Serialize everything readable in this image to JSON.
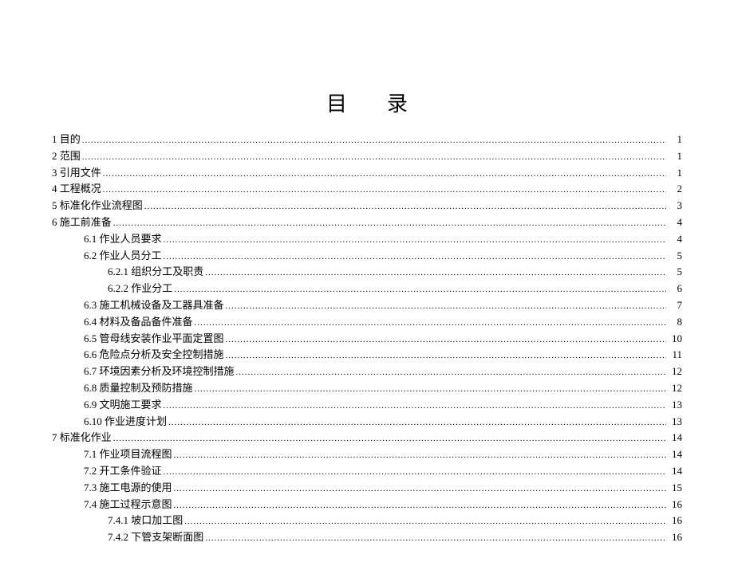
{
  "title": "目录",
  "entries": [
    {
      "label": "1 目的",
      "page": "1",
      "indent": 0
    },
    {
      "label": "2 范围",
      "page": "1",
      "indent": 0
    },
    {
      "label": "3 引用文件",
      "page": "1",
      "indent": 0
    },
    {
      "label": "4 工程概况",
      "page": "2",
      "indent": 0
    },
    {
      "label": "5 标准化作业流程图",
      "page": "3",
      "indent": 0
    },
    {
      "label": "6 施工前准备",
      "page": "4",
      "indent": 0
    },
    {
      "label": "6.1 作业人员要求",
      "page": "4",
      "indent": 1
    },
    {
      "label": "6.2 作业人员分工",
      "page": "5",
      "indent": 1
    },
    {
      "label": "6.2.1 组织分工及职责",
      "page": "5",
      "indent": 2
    },
    {
      "label": "6.2.2 作业分工",
      "page": "6",
      "indent": 2
    },
    {
      "label": "6.3 施工机械设备及工器具准备",
      "page": "7",
      "indent": 1
    },
    {
      "label": "6.4 材料及备品备件准备",
      "page": "8",
      "indent": 1
    },
    {
      "label": "6.5 管母线安装作业平面定置图",
      "page": "10",
      "indent": 1
    },
    {
      "label": "6.6 危险点分析及安全控制措施",
      "page": "11",
      "indent": 1
    },
    {
      "label": "6.7 环境因素分析及环境控制措施",
      "page": "12",
      "indent": 1
    },
    {
      "label": "6.8 质量控制及预防措施",
      "page": "12",
      "indent": 1
    },
    {
      "label": "6.9 文明施工要求",
      "page": "13",
      "indent": 1
    },
    {
      "label": "6.10 作业进度计划",
      "page": "13",
      "indent": 1
    },
    {
      "label": "7 标准化作业",
      "page": "14",
      "indent": 0
    },
    {
      "label": "7.1 作业项目流程图",
      "page": "14",
      "indent": 1
    },
    {
      "label": "7.2 开工条件验证",
      "page": "14",
      "indent": 1
    },
    {
      "label": "7.3 施工电源的使用",
      "page": "15",
      "indent": 1
    },
    {
      "label": "7.4 施工过程示意图",
      "page": "16",
      "indent": 1
    },
    {
      "label": "7.4.1 坡口加工图",
      "page": "16",
      "indent": 2
    },
    {
      "label": "7.4.2 下管支架断面图",
      "page": "16",
      "indent": 2
    }
  ]
}
